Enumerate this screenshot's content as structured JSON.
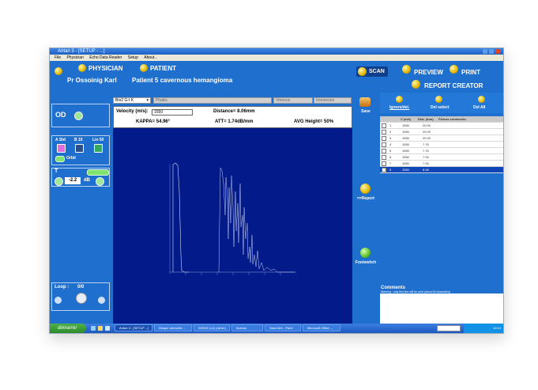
{
  "window": {
    "title": "Antan 3 - [SETUP - ...]"
  },
  "menu": [
    "File",
    "Physician",
    "Echo Data Reader",
    "Setup",
    "About..."
  ],
  "header": {
    "physician_label": "PHYSICIAN",
    "physician_name": "Pr Ossoinig Karl",
    "patient_label": "PATIENT",
    "patient_name": "Patient 5 cavernous hemangioma",
    "scan": "SCAN",
    "preview": "PREVIEW",
    "print": "PRINT",
    "report_creator": "REPORT CREATOR"
  },
  "left": {
    "eye": "OD",
    "astd": "A Std",
    "b10": "B 10",
    "lin50": "Lin 50",
    "orbit": "Orbit",
    "t": "T",
    "gain_value": "-2.2",
    "gain_unit": "dB",
    "loop": "Loop :",
    "loop_value": "0/0"
  },
  "toolbar": {
    "probe": "Bio2 G-I K",
    "d2": "Phakic",
    "d3": "Vitreous",
    "d4": "Immersion"
  },
  "info": {
    "velocity_label": "Velocity (m/s):",
    "velocity_value": "1550",
    "distance": "Distance= 8.06mm",
    "kappa": "KAPPA= 54.96°",
    "att": "ATT= 1.74dB/mm",
    "avg": "AVG Height= 50%"
  },
  "mid": {
    "save": "Save",
    "report": "=>Report",
    "footswitch": "Footswitch"
  },
  "right": {
    "ignore": "Ignore/del.",
    "del_select": "Del select",
    "del_all": "Del All",
    "cols": [
      "V (m/s)",
      "Dist. (mm)",
      "Picture comments"
    ],
    "rows": [
      {
        "n": "1",
        "v": "1550",
        "d": "20.00"
      },
      {
        "n": "2",
        "v": "1550",
        "d": "20.00"
      },
      {
        "n": "3",
        "v": "1550",
        "d": "20.00"
      },
      {
        "n": "4",
        "v": "1550",
        "d": "7.76"
      },
      {
        "n": "5",
        "v": "1550",
        "d": "7.76"
      },
      {
        "n": "6",
        "v": "1550",
        "d": "7.94"
      },
      {
        "n": "7",
        "v": "1550",
        "d": "7.94"
      },
      {
        "n": "8",
        "v": "1550",
        "d": "8.06"
      }
    ],
    "comments_title": "Comments",
    "comments_warning": "Warning : only first line will be print (about 60 characters)"
  },
  "taskbar": {
    "start": "démarrer",
    "items": [
      "Antan 3 - [SETUP ...]",
      "Disque amovible ...",
      "WINXE (c2) (db:bc)",
      "Bureau",
      "Sans titre - Paint",
      "Microsoft Office ..."
    ],
    "time": "10:14"
  },
  "colors": {
    "app_blue": "#1f6fcf",
    "plot_bg": "#031b8a"
  }
}
